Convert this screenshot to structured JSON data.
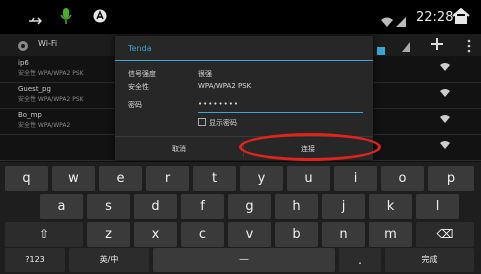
{
  "status_bar": {
    "time": "22:28",
    "icons": [
      "usb-icon",
      "mic-icon",
      "android-icon",
      "wifi-icon",
      "signal-icon",
      "home-icon"
    ]
  },
  "app": {
    "title": "Wi-Fi",
    "networks": [
      {
        "name": "ip6",
        "sub": "安全性 WPA/WPA2 PSK",
        "signal": "wifi-signal-icon"
      },
      {
        "name": "Guest_pg",
        "sub": "安全性 WPA/WPA2 PSK",
        "signal": "wifi-signal-icon"
      },
      {
        "name": "Bo_mp",
        "sub": "安全性 WPA/WPA2",
        "signal": "wifi-signal-icon"
      }
    ]
  },
  "dialog": {
    "title": "Tenda",
    "signal_label": "信号强度",
    "signal_value": "很强",
    "security_label": "安全性",
    "security_value": "WPA/WPA2 PSK",
    "password_label": "密码",
    "password_value": "••••••••",
    "show_password_label": "显示密码",
    "cancel_label": "取消",
    "connect_label": "连接"
  },
  "keyboard": {
    "row1": [
      "q",
      "w",
      "e",
      "r",
      "t",
      "y",
      "u",
      "i",
      "o",
      "p"
    ],
    "row2": [
      "a",
      "s",
      "d",
      "f",
      "g",
      "h",
      "j",
      "k",
      "l"
    ],
    "row3": [
      "z",
      "x",
      "c",
      "v",
      "b",
      "n",
      "m"
    ],
    "shift_label": "⇧",
    "backspace_label": "⌫",
    "symbols_label": "?123",
    "lang_label": "英/中",
    "space_label": "—",
    "period_label": ".",
    "done_label": "完成"
  }
}
